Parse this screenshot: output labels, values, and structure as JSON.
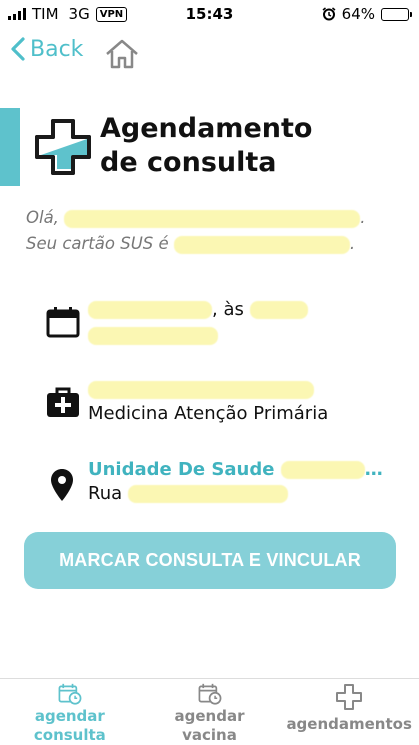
{
  "status_bar": {
    "carrier": "TIM",
    "network": "3G",
    "vpn": "VPN",
    "time": "15:43",
    "battery": "64%",
    "battery_level": 0.64,
    "icons": [
      "signal-icon",
      "alarm-icon",
      "battery-icon"
    ]
  },
  "nav": {
    "back_label": "Back",
    "icons": [
      "chevron-left-icon",
      "home-icon"
    ]
  },
  "header": {
    "title_line1": "Agendamento",
    "title_line2": "de consulta",
    "logo_icon": "medical-cross-icon"
  },
  "greeting": {
    "hello": "Olá,",
    "card_prefix": "Seu cartão SUS é"
  },
  "appointment": {
    "time_connector": ", às",
    "specialty": "Medicina Atenção Primária",
    "unit_name": "Unidade De Saude",
    "address_prefix": "Rua",
    "icons": [
      "calendar-icon",
      "medical-bag-icon",
      "location-pin-icon"
    ]
  },
  "actions": {
    "primary_label": "MARCAR CONSULTA E VINCULAR"
  },
  "tabbar": {
    "tabs": [
      {
        "line1": "agendar",
        "line2": "consulta",
        "icon": "calendar-clock-icon",
        "active": true
      },
      {
        "line1": "agendar",
        "line2": "vacina",
        "icon": "calendar-clock-icon",
        "active": false
      },
      {
        "line1": "agendamentos",
        "line2": "",
        "icon": "plus-outline-icon",
        "active": false
      }
    ]
  },
  "colors": {
    "accent": "#5ec2cc",
    "link": "#40b3bf",
    "button": "#86d0d8",
    "redaction": "#fbf7b3"
  }
}
